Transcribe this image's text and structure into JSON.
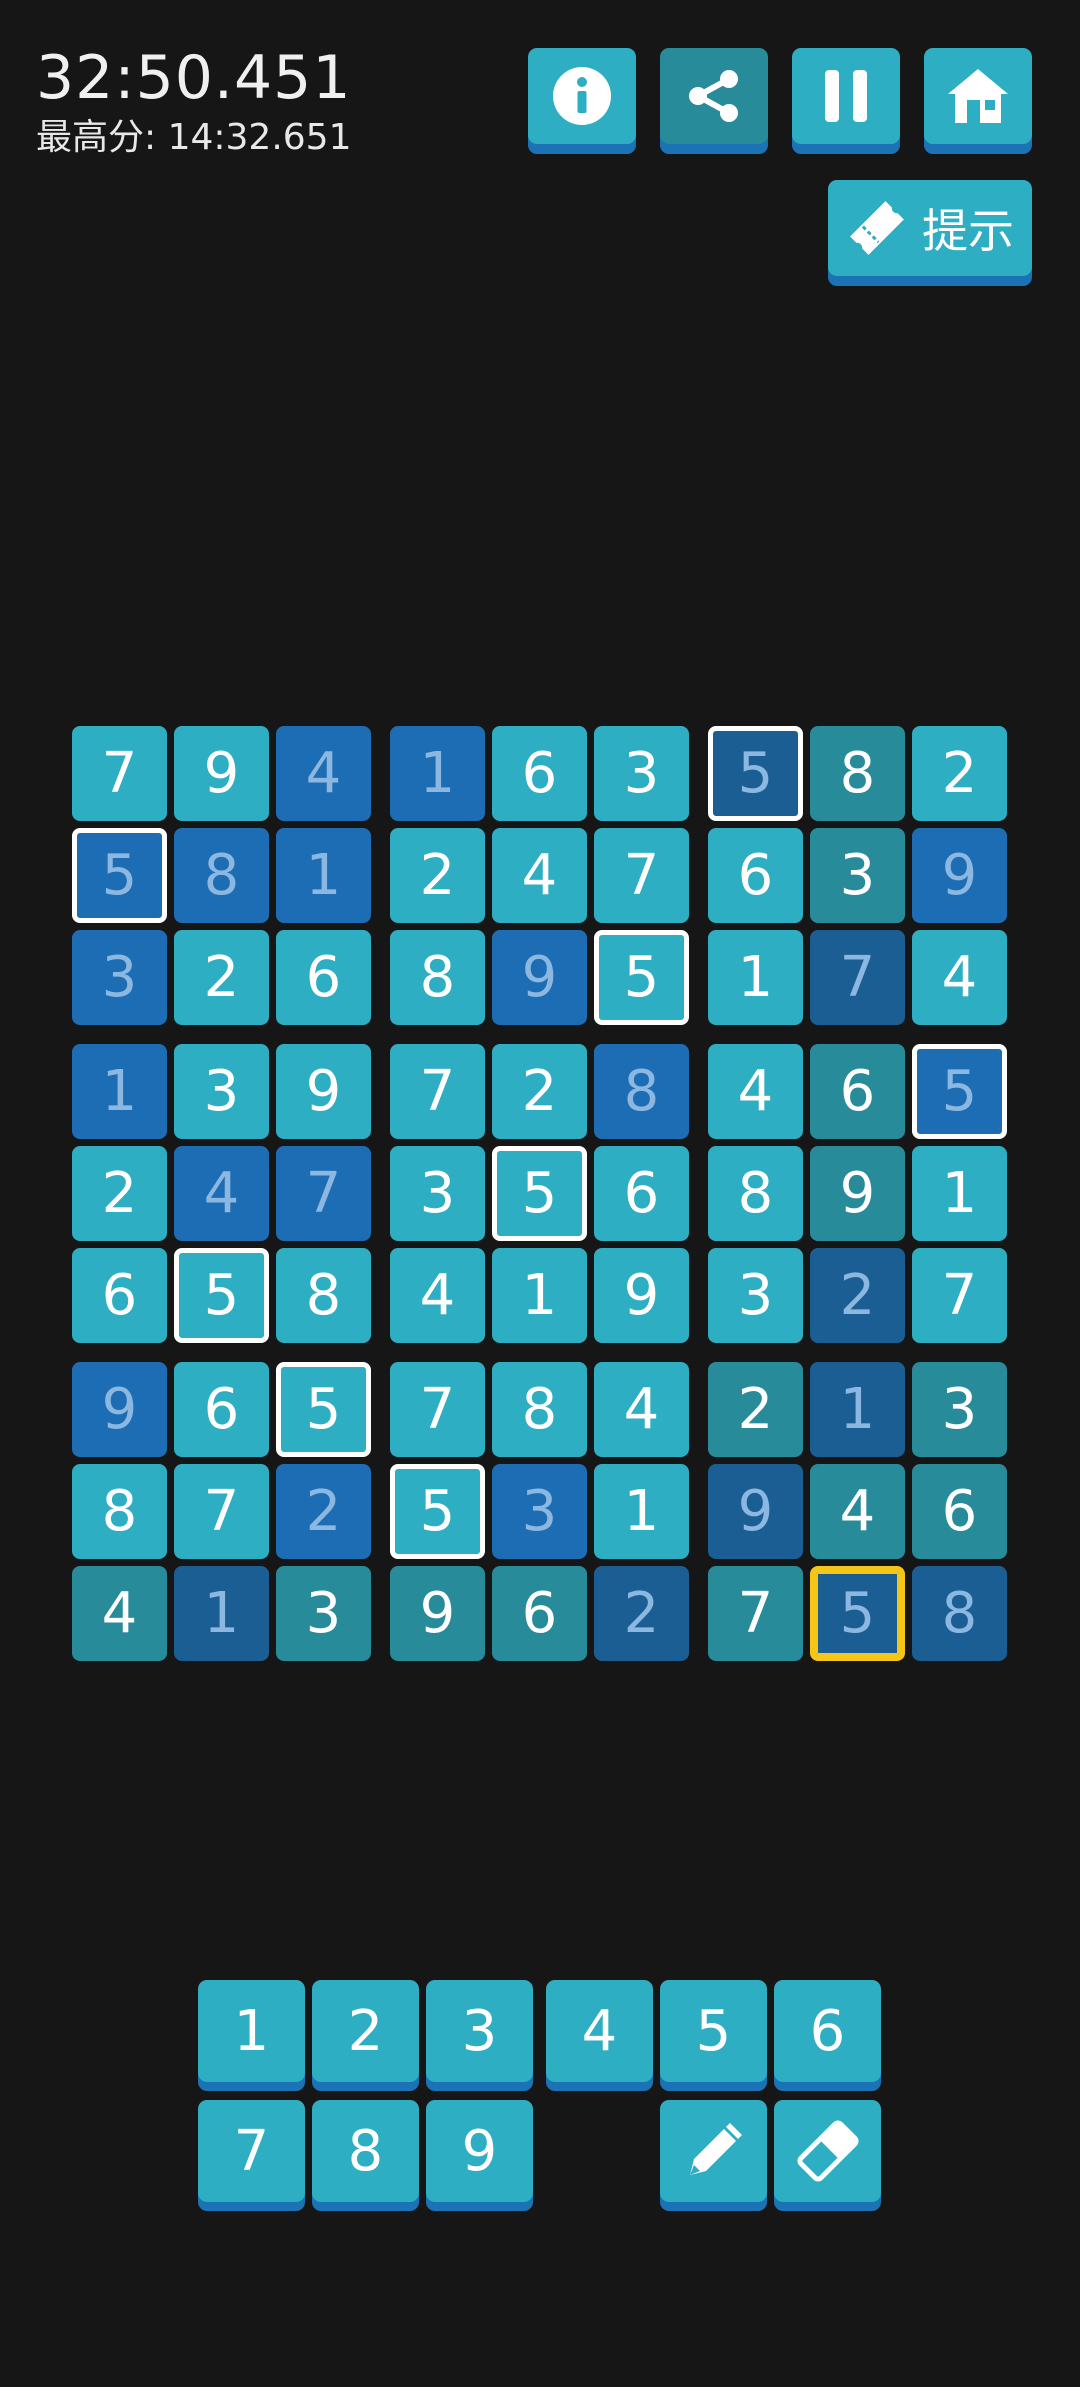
{
  "header": {
    "timer": "32:50.451",
    "best_score": "最高分: 14:32.651"
  },
  "toolbar": {
    "info_icon": "info-icon",
    "share_icon": "share-icon",
    "pause_icon": "pause-icon",
    "home_icon": "home-icon",
    "hint_label": "提示",
    "hint_icon": "ticket-icon"
  },
  "board": {
    "rows": [
      [
        "7",
        "9",
        "4",
        "1",
        "6",
        "3",
        "5",
        "8",
        "2"
      ],
      [
        "5",
        "8",
        "1",
        "2",
        "4",
        "7",
        "6",
        "3",
        "9"
      ],
      [
        "3",
        "2",
        "6",
        "8",
        "9",
        "5",
        "1",
        "7",
        "4"
      ],
      [
        "1",
        "3",
        "9",
        "7",
        "2",
        "8",
        "4",
        "6",
        "5"
      ],
      [
        "2",
        "4",
        "7",
        "3",
        "5",
        "6",
        "8",
        "9",
        "1"
      ],
      [
        "6",
        "5",
        "8",
        "4",
        "1",
        "9",
        "3",
        "2",
        "7"
      ],
      [
        "9",
        "6",
        "5",
        "7",
        "8",
        "4",
        "2",
        "1",
        "3"
      ],
      [
        "8",
        "7",
        "2",
        "5",
        "3",
        "1",
        "9",
        "4",
        "6"
      ],
      [
        "4",
        "1",
        "3",
        "9",
        "6",
        "2",
        "7",
        "5",
        "8"
      ]
    ],
    "colors": [
      [
        "cyan",
        "cyan",
        "blue",
        "blue",
        "cyan",
        "cyan",
        "navy",
        "teal",
        "cyan"
      ],
      [
        "blue",
        "blue",
        "blue",
        "cyan",
        "cyan",
        "cyan",
        "cyan",
        "teal",
        "blue"
      ],
      [
        "blue",
        "cyan",
        "cyan",
        "cyan",
        "blue",
        "cyan",
        "cyan",
        "navy",
        "cyan"
      ],
      [
        "blue",
        "cyan",
        "cyan",
        "cyan",
        "cyan",
        "blue",
        "cyan",
        "teal",
        "blue"
      ],
      [
        "cyan",
        "blue",
        "blue",
        "cyan",
        "cyan",
        "cyan",
        "cyan",
        "teal",
        "cyan"
      ],
      [
        "cyan",
        "cyan",
        "cyan",
        "cyan",
        "cyan",
        "cyan",
        "cyan",
        "navy",
        "cyan"
      ],
      [
        "blue",
        "cyan",
        "cyan",
        "cyan",
        "cyan",
        "cyan",
        "teal",
        "navy",
        "teal"
      ],
      [
        "cyan",
        "cyan",
        "blue",
        "cyan",
        "blue",
        "cyan",
        "navy",
        "teal",
        "teal"
      ],
      [
        "teal",
        "navy",
        "teal",
        "teal",
        "teal",
        "navy",
        "teal",
        "navy",
        "navy"
      ]
    ],
    "outlined": [
      [
        0,
        6
      ],
      [
        1,
        0
      ],
      [
        2,
        5
      ],
      [
        3,
        8
      ],
      [
        4,
        4
      ],
      [
        5,
        1
      ],
      [
        6,
        2
      ],
      [
        7,
        3
      ]
    ],
    "selected": [
      8,
      7
    ]
  },
  "keypad": {
    "row1": [
      "1",
      "2",
      "3",
      "4",
      "5",
      "6"
    ],
    "row2": [
      "7",
      "8",
      "9"
    ],
    "pencil_icon": "pencil-icon",
    "eraser_icon": "eraser-icon"
  },
  "colors": {
    "background": "#161616",
    "cyan": "#2eaec2",
    "teal": "#278b9a",
    "blue": "#1d6db5",
    "navy": "#1a5e93",
    "selection": "#f5c518"
  }
}
